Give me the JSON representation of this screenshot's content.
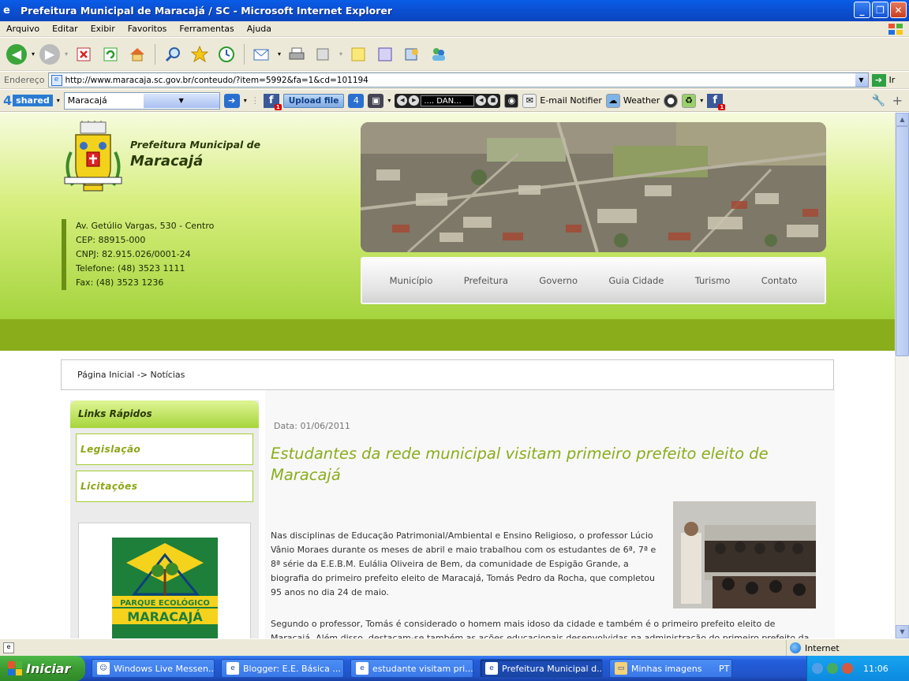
{
  "window": {
    "title": "Prefeitura Municipal de Maracajá / SC - Microsoft Internet Explorer"
  },
  "menu": [
    "Arquivo",
    "Editar",
    "Exibir",
    "Favoritos",
    "Ferramentas",
    "Ajuda"
  ],
  "address": {
    "label": "Endereço",
    "url": "http://www.maracaja.sc.gov.br/conteudo/?item=5992&fa=1&cd=101194",
    "go_label": "Ir"
  },
  "toolbar4shared": {
    "logo_num": "4",
    "logo_text": "shared",
    "search_value": "Maracajá",
    "upload_label": "Upload file",
    "player_display": ".... DAN...",
    "email_label": "E-mail Notifier",
    "weather_label": "Weather",
    "fb_badge": "1"
  },
  "site": {
    "name_line1": "Prefeitura Municipal de",
    "name_line2": "Maracajá",
    "address_lines": [
      "Av. Getúlio Vargas, 530 - Centro",
      "CEP: 88915-000",
      "CNPJ: 82.915.026/0001-24",
      "Telefone: (48) 3523 1111",
      "Fax: (48) 3523 1236"
    ],
    "nav": [
      "Município",
      "Prefeitura",
      "Governo",
      "Guia Cidade",
      "Turismo",
      "Contato"
    ],
    "breadcrumb": "Página Inicial -> Notícias",
    "quick_links_title": "Links Rápidos",
    "quick_links": [
      "Legislação",
      "Licitações"
    ],
    "park_line1": "MARACAJÁ",
    "park_line2": "PARQUE ECOLÓGICO"
  },
  "article": {
    "date": "Data: 01/06/2011",
    "headline": "Estudantes da rede municipal visitam primeiro prefeito eleito de Maracajá",
    "para1": "Nas disciplinas de Educação Patrimonial/Ambiental e Ensino Religioso, o professor Lúcio Vânio Moraes durante os meses de abril e maio trabalhou com os estudantes de 6ª, 7ª e 8ª série da E.E.B.M. Eulália Oliveira de Bem, da comunidade de Espigão Grande, a biografia do primeiro prefeito eleito de Maracajá, Tomás Pedro da Rocha, que completou 95 anos no dia 24 de maio.",
    "para2": "Segundo o professor, Tomás é considerado o homem mais idoso da cidade e também é o primeiro prefeito eleito de Maracajá. Além disso, destacam-se também as ações educacionais desenvolvidas na administração do primeiro prefeito da"
  },
  "status": {
    "zone": "Internet"
  },
  "taskbar": {
    "start": "Iniciar",
    "tasks": [
      "Windows Live Messen...",
      "Blogger: E.E. Básica ...",
      "estudante visitam pri...",
      "Prefeitura Municipal d...",
      "Minhas imagens"
    ],
    "lang": "PT",
    "clock": "11:06"
  }
}
